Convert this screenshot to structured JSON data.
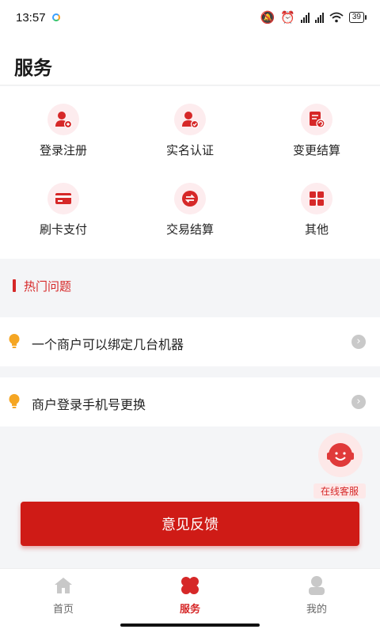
{
  "status_bar": {
    "time": "13:57",
    "battery": "39"
  },
  "header": {
    "title": "服务"
  },
  "services": [
    {
      "label": "登录注册",
      "icon": "user-add-icon"
    },
    {
      "label": "实名认证",
      "icon": "user-verified-icon"
    },
    {
      "label": "变更结算",
      "icon": "document-change-icon"
    },
    {
      "label": "刷卡支付",
      "icon": "card-icon"
    },
    {
      "label": "交易结算",
      "icon": "exchange-icon"
    },
    {
      "label": "其他",
      "icon": "grid-icon"
    }
  ],
  "hot": {
    "title": "热门问题",
    "questions": [
      {
        "text": "一个商户可以绑定几台机器"
      },
      {
        "text": "商户登录手机号更换"
      }
    ]
  },
  "customer_service": {
    "label": "在线客服"
  },
  "feedback": {
    "label": "意见反馈"
  },
  "tabs": [
    {
      "label": "首页",
      "icon": "home-icon",
      "active": false
    },
    {
      "label": "服务",
      "icon": "clover-icon",
      "active": true
    },
    {
      "label": "我的",
      "icon": "profile-icon",
      "active": false
    }
  ],
  "colors": {
    "accent": "#d62828",
    "button": "#cf1b16",
    "icon_bg": "#fdecee",
    "bulb": "#f5a623"
  }
}
